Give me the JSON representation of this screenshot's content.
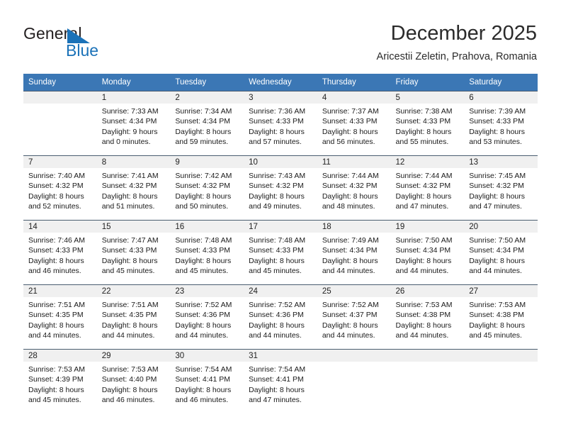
{
  "brand": {
    "word_general": "General",
    "word_blue": "Blue",
    "logo_icon": "triangle-logo-icon",
    "accent_color": "#1b72b8"
  },
  "header": {
    "title": "December 2025",
    "subtitle": "Aricestii Zeletin, Prahova, Romania"
  },
  "calendar": {
    "header_bg": "#3b77b5",
    "daynum_bg": "#f0f0f0",
    "weekdays": [
      "Sunday",
      "Monday",
      "Tuesday",
      "Wednesday",
      "Thursday",
      "Friday",
      "Saturday"
    ],
    "weeks": [
      [
        {
          "day": "",
          "lines": [
            "",
            "",
            "",
            ""
          ]
        },
        {
          "day": "1",
          "lines": [
            "Sunrise: 7:33 AM",
            "Sunset: 4:34 PM",
            "Daylight: 9 hours",
            "and 0 minutes."
          ]
        },
        {
          "day": "2",
          "lines": [
            "Sunrise: 7:34 AM",
            "Sunset: 4:34 PM",
            "Daylight: 8 hours",
            "and 59 minutes."
          ]
        },
        {
          "day": "3",
          "lines": [
            "Sunrise: 7:36 AM",
            "Sunset: 4:33 PM",
            "Daylight: 8 hours",
            "and 57 minutes."
          ]
        },
        {
          "day": "4",
          "lines": [
            "Sunrise: 7:37 AM",
            "Sunset: 4:33 PM",
            "Daylight: 8 hours",
            "and 56 minutes."
          ]
        },
        {
          "day": "5",
          "lines": [
            "Sunrise: 7:38 AM",
            "Sunset: 4:33 PM",
            "Daylight: 8 hours",
            "and 55 minutes."
          ]
        },
        {
          "day": "6",
          "lines": [
            "Sunrise: 7:39 AM",
            "Sunset: 4:33 PM",
            "Daylight: 8 hours",
            "and 53 minutes."
          ]
        }
      ],
      [
        {
          "day": "7",
          "lines": [
            "Sunrise: 7:40 AM",
            "Sunset: 4:32 PM",
            "Daylight: 8 hours",
            "and 52 minutes."
          ]
        },
        {
          "day": "8",
          "lines": [
            "Sunrise: 7:41 AM",
            "Sunset: 4:32 PM",
            "Daylight: 8 hours",
            "and 51 minutes."
          ]
        },
        {
          "day": "9",
          "lines": [
            "Sunrise: 7:42 AM",
            "Sunset: 4:32 PM",
            "Daylight: 8 hours",
            "and 50 minutes."
          ]
        },
        {
          "day": "10",
          "lines": [
            "Sunrise: 7:43 AM",
            "Sunset: 4:32 PM",
            "Daylight: 8 hours",
            "and 49 minutes."
          ]
        },
        {
          "day": "11",
          "lines": [
            "Sunrise: 7:44 AM",
            "Sunset: 4:32 PM",
            "Daylight: 8 hours",
            "and 48 minutes."
          ]
        },
        {
          "day": "12",
          "lines": [
            "Sunrise: 7:44 AM",
            "Sunset: 4:32 PM",
            "Daylight: 8 hours",
            "and 47 minutes."
          ]
        },
        {
          "day": "13",
          "lines": [
            "Sunrise: 7:45 AM",
            "Sunset: 4:32 PM",
            "Daylight: 8 hours",
            "and 47 minutes."
          ]
        }
      ],
      [
        {
          "day": "14",
          "lines": [
            "Sunrise: 7:46 AM",
            "Sunset: 4:33 PM",
            "Daylight: 8 hours",
            "and 46 minutes."
          ]
        },
        {
          "day": "15",
          "lines": [
            "Sunrise: 7:47 AM",
            "Sunset: 4:33 PM",
            "Daylight: 8 hours",
            "and 45 minutes."
          ]
        },
        {
          "day": "16",
          "lines": [
            "Sunrise: 7:48 AM",
            "Sunset: 4:33 PM",
            "Daylight: 8 hours",
            "and 45 minutes."
          ]
        },
        {
          "day": "17",
          "lines": [
            "Sunrise: 7:48 AM",
            "Sunset: 4:33 PM",
            "Daylight: 8 hours",
            "and 45 minutes."
          ]
        },
        {
          "day": "18",
          "lines": [
            "Sunrise: 7:49 AM",
            "Sunset: 4:34 PM",
            "Daylight: 8 hours",
            "and 44 minutes."
          ]
        },
        {
          "day": "19",
          "lines": [
            "Sunrise: 7:50 AM",
            "Sunset: 4:34 PM",
            "Daylight: 8 hours",
            "and 44 minutes."
          ]
        },
        {
          "day": "20",
          "lines": [
            "Sunrise: 7:50 AM",
            "Sunset: 4:34 PM",
            "Daylight: 8 hours",
            "and 44 minutes."
          ]
        }
      ],
      [
        {
          "day": "21",
          "lines": [
            "Sunrise: 7:51 AM",
            "Sunset: 4:35 PM",
            "Daylight: 8 hours",
            "and 44 minutes."
          ]
        },
        {
          "day": "22",
          "lines": [
            "Sunrise: 7:51 AM",
            "Sunset: 4:35 PM",
            "Daylight: 8 hours",
            "and 44 minutes."
          ]
        },
        {
          "day": "23",
          "lines": [
            "Sunrise: 7:52 AM",
            "Sunset: 4:36 PM",
            "Daylight: 8 hours",
            "and 44 minutes."
          ]
        },
        {
          "day": "24",
          "lines": [
            "Sunrise: 7:52 AM",
            "Sunset: 4:36 PM",
            "Daylight: 8 hours",
            "and 44 minutes."
          ]
        },
        {
          "day": "25",
          "lines": [
            "Sunrise: 7:52 AM",
            "Sunset: 4:37 PM",
            "Daylight: 8 hours",
            "and 44 minutes."
          ]
        },
        {
          "day": "26",
          "lines": [
            "Sunrise: 7:53 AM",
            "Sunset: 4:38 PM",
            "Daylight: 8 hours",
            "and 44 minutes."
          ]
        },
        {
          "day": "27",
          "lines": [
            "Sunrise: 7:53 AM",
            "Sunset: 4:38 PM",
            "Daylight: 8 hours",
            "and 45 minutes."
          ]
        }
      ],
      [
        {
          "day": "28",
          "lines": [
            "Sunrise: 7:53 AM",
            "Sunset: 4:39 PM",
            "Daylight: 8 hours",
            "and 45 minutes."
          ]
        },
        {
          "day": "29",
          "lines": [
            "Sunrise: 7:53 AM",
            "Sunset: 4:40 PM",
            "Daylight: 8 hours",
            "and 46 minutes."
          ]
        },
        {
          "day": "30",
          "lines": [
            "Sunrise: 7:54 AM",
            "Sunset: 4:41 PM",
            "Daylight: 8 hours",
            "and 46 minutes."
          ]
        },
        {
          "day": "31",
          "lines": [
            "Sunrise: 7:54 AM",
            "Sunset: 4:41 PM",
            "Daylight: 8 hours",
            "and 47 minutes."
          ]
        },
        {
          "day": "",
          "lines": [
            "",
            "",
            "",
            ""
          ]
        },
        {
          "day": "",
          "lines": [
            "",
            "",
            "",
            ""
          ]
        },
        {
          "day": "",
          "lines": [
            "",
            "",
            "",
            ""
          ]
        }
      ]
    ]
  }
}
